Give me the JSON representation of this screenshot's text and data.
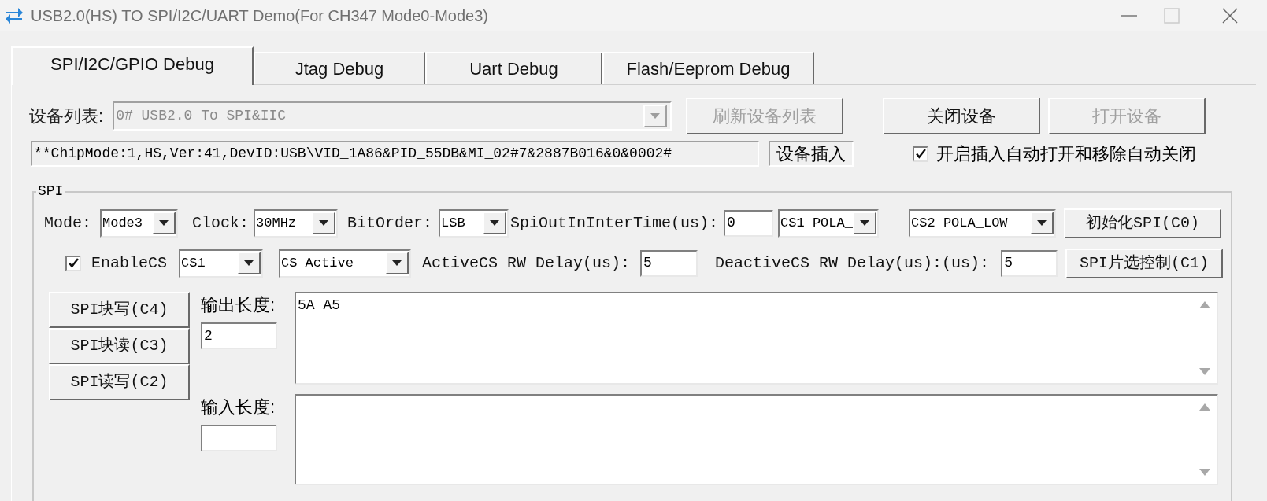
{
  "window": {
    "title": "USB2.0(HS) TO SPI/I2C/UART Demo(For CH347 Mode0-Mode3)"
  },
  "tabs": [
    {
      "label": "SPI/I2C/GPIO Debug",
      "selected": true
    },
    {
      "label": "Jtag Debug",
      "selected": false
    },
    {
      "label": "Uart Debug",
      "selected": false
    },
    {
      "label": "Flash/Eeprom Debug",
      "selected": false
    }
  ],
  "device_list": {
    "label": "设备列表:",
    "value": "0# USB2.0 To SPI&IIC",
    "disabled": true
  },
  "device_buttons": [
    {
      "label": "刷新设备列表",
      "disabled": true
    },
    {
      "label": "关闭设备",
      "disabled": false
    },
    {
      "label": "打开设备",
      "disabled": true
    }
  ],
  "device_info": "**ChipMode:1,HS,Ver:41,DevID:USB\\VID_1A86&PID_55DB&MI_02#7&2887B016&0&0002#",
  "device_status": "设备插入",
  "auto_open": {
    "label": "开启插入自动打开和移除自动关闭",
    "checked": true
  },
  "spi": {
    "title": "SPI",
    "settings": [
      {
        "kind": "label",
        "text": "Mode:"
      },
      {
        "kind": "select",
        "value": "Mode3"
      },
      {
        "kind": "label",
        "text": "Clock:"
      },
      {
        "kind": "select",
        "value": "30MHz"
      },
      {
        "kind": "label",
        "text": "BitOrder:"
      },
      {
        "kind": "select",
        "value": "LSB"
      },
      {
        "kind": "label",
        "text": "SpiOutInInterTime(us):"
      },
      {
        "kind": "input",
        "value": "0"
      },
      {
        "kind": "select",
        "value": "CS1 POLA_"
      },
      {
        "kind": "select",
        "value": "CS2 POLA_LOW"
      },
      {
        "kind": "button",
        "text": "初始化SPI(C0)"
      }
    ],
    "chip_select": [
      {
        "kind": "checkbox",
        "checked": true
      },
      {
        "kind": "label",
        "text": "EnableCS"
      },
      {
        "kind": "select",
        "value": "CS1"
      },
      {
        "kind": "select",
        "value": "CS Active"
      },
      {
        "kind": "label",
        "text": "ActiveCS RW Delay(us):"
      },
      {
        "kind": "input",
        "value": "5"
      },
      {
        "kind": "label",
        "text": "DeactiveCS RW Delay(us):(us):"
      },
      {
        "kind": "input",
        "value": "5"
      },
      {
        "kind": "button",
        "text": "SPI片选控制(C1)"
      }
    ],
    "buttons": [
      "SPI块写(C4)",
      "SPI块读(C3)",
      "SPI读写(C2)"
    ],
    "output": {
      "label": "输出长度:",
      "length": "2",
      "data": "5A A5"
    },
    "input": {
      "label": "输入长度:"
    }
  }
}
